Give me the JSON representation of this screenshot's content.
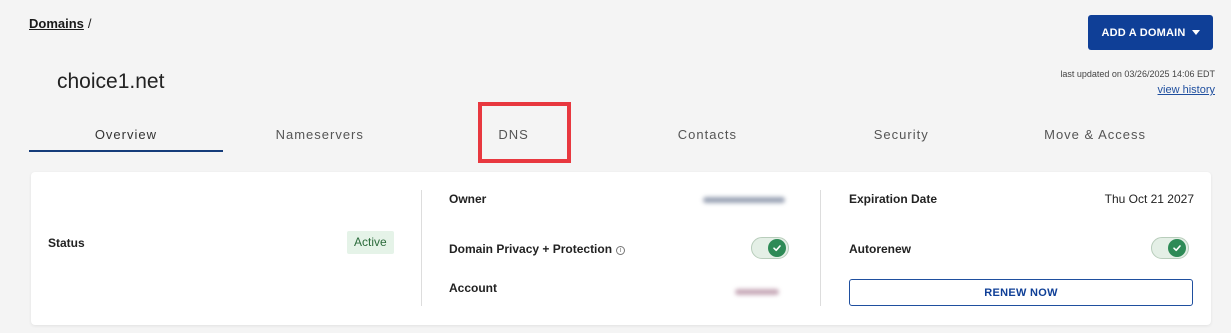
{
  "breadcrumb": {
    "link": "Domains",
    "separator": "/"
  },
  "header": {
    "add_domain_label": "ADD A DOMAIN",
    "domain_name": "choice1.net",
    "last_updated": "last updated on 03/26/2025 14:06 EDT",
    "view_history": "view history"
  },
  "tabs": [
    {
      "label": "Overview",
      "active": true
    },
    {
      "label": "Nameservers"
    },
    {
      "label": "DNS",
      "highlighted": true
    },
    {
      "label": "Contacts"
    },
    {
      "label": "Security"
    },
    {
      "label": "Move & Access"
    }
  ],
  "card": {
    "status_label": "Status",
    "status_value": "Active",
    "owner_label": "Owner",
    "privacy_label": "Domain Privacy + Protection",
    "privacy_enabled": true,
    "account_label": "Account",
    "expiration_label": "Expiration Date",
    "expiration_value": "Thu Oct 21 2027",
    "autorenew_label": "Autorenew",
    "autorenew_enabled": true,
    "renew_button": "RENEW NOW"
  },
  "colors": {
    "primary": "#0f3f97",
    "success": "#2e8b57",
    "highlight": "#e8383f",
    "badge_bg": "#e5f3e8"
  },
  "icons": {
    "dropdown": "caret-down-icon",
    "info": "info-icon",
    "toggle_check": "check-icon"
  }
}
